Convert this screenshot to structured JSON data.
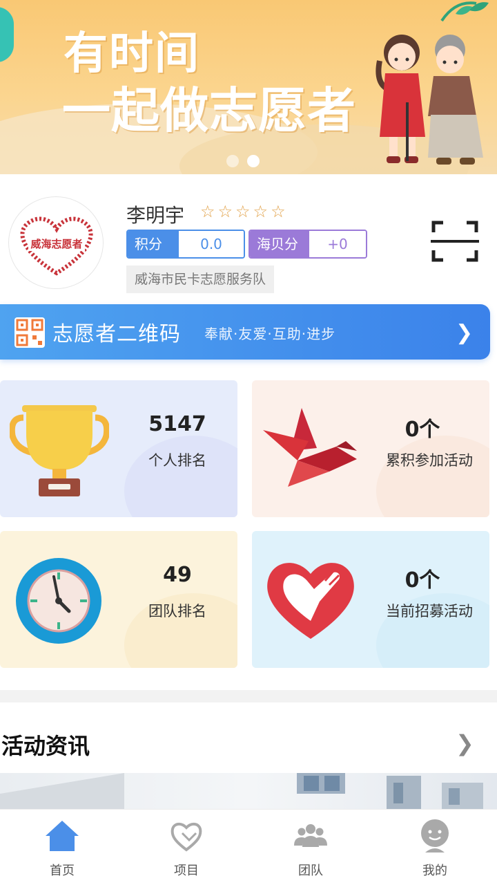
{
  "banner": {
    "line1": "有时间",
    "line2": "一起做志愿者",
    "slide_count": 2,
    "active_slide": 2
  },
  "profile": {
    "name": "李明宇",
    "star_count": 5,
    "points_label": "积分",
    "points_value": "0.0",
    "shells_label": "海贝分",
    "shells_value": "+0",
    "team": "威海市民卡志愿服务队",
    "logo_text": "威海志愿者"
  },
  "qr_bar": {
    "title": "志愿者二维码",
    "slogan": "奉献·友爱·互助·进步"
  },
  "stats": [
    {
      "value": "5147",
      "label": "个人排名",
      "icon": "trophy-icon"
    },
    {
      "value": "0个",
      "label": "累积参加活动",
      "icon": "dove-icon"
    },
    {
      "value": "49",
      "label": "团队排名",
      "icon": "clock-icon"
    },
    {
      "value": "0个",
      "label": "当前招募活动",
      "icon": "heart-hand-icon"
    }
  ],
  "news": {
    "title": "活动资讯"
  },
  "tabbar": {
    "items": [
      {
        "label": "首页",
        "icon": "home-icon",
        "active": true
      },
      {
        "label": "项目",
        "icon": "heart-outline-icon",
        "active": false
      },
      {
        "label": "团队",
        "icon": "group-icon",
        "active": false
      },
      {
        "label": "我的",
        "icon": "user-face-icon",
        "active": false
      }
    ]
  },
  "colors": {
    "primary": "#3b82ea",
    "points": "#4b8fe8",
    "shells": "#9b7ad8",
    "star": "#e2a24a"
  }
}
